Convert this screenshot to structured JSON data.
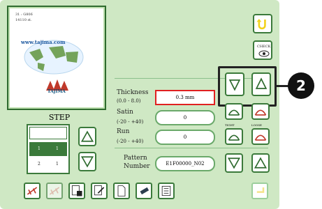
{
  "preview": {
    "line1": "31 : G806",
    "line2": "14110 st.",
    "url_text": "www.tajima.com",
    "logo_text": "TAJIMA"
  },
  "step": {
    "label": "STEP",
    "rows": [
      {
        "col1": "1",
        "col2": "1"
      },
      {
        "col1": "2",
        "col2": "1"
      }
    ]
  },
  "params": {
    "thickness_label": "Thickness",
    "thickness_range": "(0.0 - 8.0)",
    "thickness_value": "0.3 mm",
    "satin_label": "Satin",
    "satin_range": "(-20 - +40)",
    "satin_value": "0",
    "run_label": "Run",
    "run_range": "(-20 - +40)",
    "run_value": "0",
    "pattern_label_1": "Pattern",
    "pattern_label_2": "Number",
    "pattern_value": "E1F00000_N02"
  },
  "buttons": {
    "check_label": "CHECK",
    "tight_label": "TIGHT",
    "loose_label": "LOOSE"
  },
  "callout": {
    "number": "2"
  },
  "colors": {
    "panel": "#cfe8c4",
    "accent": "#3b7a3b",
    "highlight_red": "#e02020",
    "yellow": "#f2d21b"
  }
}
